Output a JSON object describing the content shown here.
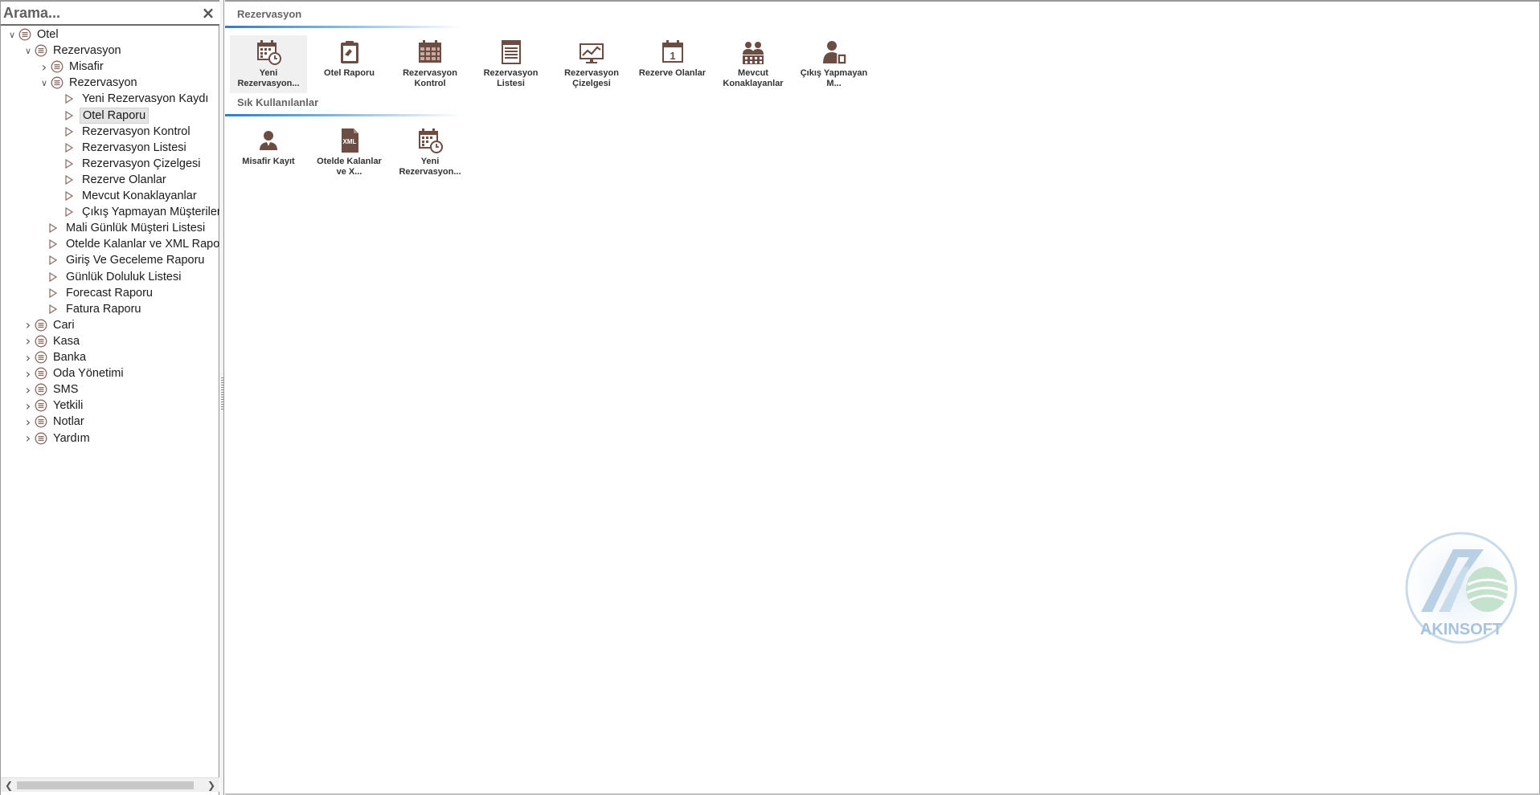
{
  "search": {
    "placeholder": "Arama..."
  },
  "close_glyph": "×",
  "tree": [
    {
      "label": "Otel",
      "level": 0,
      "expander": "open",
      "icon": "module-icon"
    },
    {
      "label": "Rezervasyon",
      "level": 1,
      "expander": "open",
      "icon": "module-icon"
    },
    {
      "label": "Misafir",
      "level": 2,
      "expander": "closed",
      "icon": "module-icon"
    },
    {
      "label": "Rezervasyon",
      "level": 2,
      "expander": "open",
      "icon": "module-icon"
    },
    {
      "label": "Yeni Rezervasyon Kaydı",
      "level": 3,
      "expander": "none",
      "icon": "leaf-icon"
    },
    {
      "label": "Otel Raporu",
      "level": 3,
      "expander": "none",
      "icon": "leaf-icon",
      "selected": true
    },
    {
      "label": "Rezervasyon Kontrol",
      "level": 3,
      "expander": "none",
      "icon": "leaf-icon"
    },
    {
      "label": "Rezervasyon Listesi",
      "level": 3,
      "expander": "none",
      "icon": "leaf-icon"
    },
    {
      "label": "Rezervasyon Çizelgesi",
      "level": 3,
      "expander": "none",
      "icon": "leaf-icon"
    },
    {
      "label": "Rezerve Olanlar",
      "level": 3,
      "expander": "none",
      "icon": "leaf-icon"
    },
    {
      "label": "Mevcut Konaklayanlar",
      "level": 3,
      "expander": "none",
      "icon": "leaf-icon"
    },
    {
      "label": "Çıkış Yapmayan Müşteriler",
      "level": 3,
      "expander": "none",
      "icon": "leaf-icon"
    },
    {
      "label": "Mali Günlük Müşteri Listesi",
      "level": 2,
      "expander": "none",
      "icon": "leaf-icon"
    },
    {
      "label": "Otelde Kalanlar ve XML Raporu",
      "level": 2,
      "expander": "none",
      "icon": "leaf-icon"
    },
    {
      "label": "Giriş Ve Geceleme Raporu",
      "level": 2,
      "expander": "none",
      "icon": "leaf-icon"
    },
    {
      "label": "Günlük Doluluk Listesi",
      "level": 2,
      "expander": "none",
      "icon": "leaf-icon"
    },
    {
      "label": "Forecast Raporu",
      "level": 2,
      "expander": "none",
      "icon": "leaf-icon"
    },
    {
      "label": "Fatura Raporu",
      "level": 2,
      "expander": "none",
      "icon": "leaf-icon"
    },
    {
      "label": "Cari",
      "level": 1,
      "expander": "closed",
      "icon": "module-icon"
    },
    {
      "label": "Kasa",
      "level": 1,
      "expander": "closed",
      "icon": "module-icon"
    },
    {
      "label": "Banka",
      "level": 1,
      "expander": "closed",
      "icon": "module-icon"
    },
    {
      "label": "Oda Yönetimi",
      "level": 1,
      "expander": "closed",
      "icon": "module-icon"
    },
    {
      "label": "SMS",
      "level": 1,
      "expander": "closed",
      "icon": "module-icon"
    },
    {
      "label": "Yetkili",
      "level": 1,
      "expander": "closed",
      "icon": "module-icon"
    },
    {
      "label": "Notlar",
      "level": 1,
      "expander": "closed",
      "icon": "module-icon"
    },
    {
      "label": "Yardım",
      "level": 1,
      "expander": "closed",
      "icon": "module-icon"
    }
  ],
  "groups": [
    {
      "title": "Rezervasyon",
      "tiles": [
        {
          "label": "Yeni Rezervasyon...",
          "icon": "calendar-clock-icon",
          "hover": true
        },
        {
          "label": "Otel Raporu",
          "icon": "clipboard-icon"
        },
        {
          "label": "Rezervasyon Kontrol",
          "icon": "grid-calendar-icon"
        },
        {
          "label": "Rezervasyon Listesi",
          "icon": "list-document-icon"
        },
        {
          "label": "Rezervasyon Çizelgesi",
          "icon": "chart-board-icon"
        },
        {
          "label": "Rezerve Olanlar",
          "icon": "calendar-day-icon"
        },
        {
          "label": "Mevcut Konaklayanlar",
          "icon": "people-building-icon"
        },
        {
          "label": "Çıkış Yapmayan M...",
          "icon": "person-door-icon"
        }
      ]
    },
    {
      "title": "Sık Kullanılanlar",
      "tiles": [
        {
          "label": "Misafir Kayıt",
          "icon": "person-icon"
        },
        {
          "label": "Otelde Kalanlar ve X...",
          "icon": "xml-file-icon"
        },
        {
          "label": "Yeni Rezervasyon...",
          "icon": "calendar-clock-icon"
        }
      ]
    }
  ],
  "watermark": {
    "text": "AKINSOFT"
  },
  "colors": {
    "icon": "#6b4d44",
    "accent_line": "#2f7fc0",
    "watermark": "#a8c4dc"
  }
}
